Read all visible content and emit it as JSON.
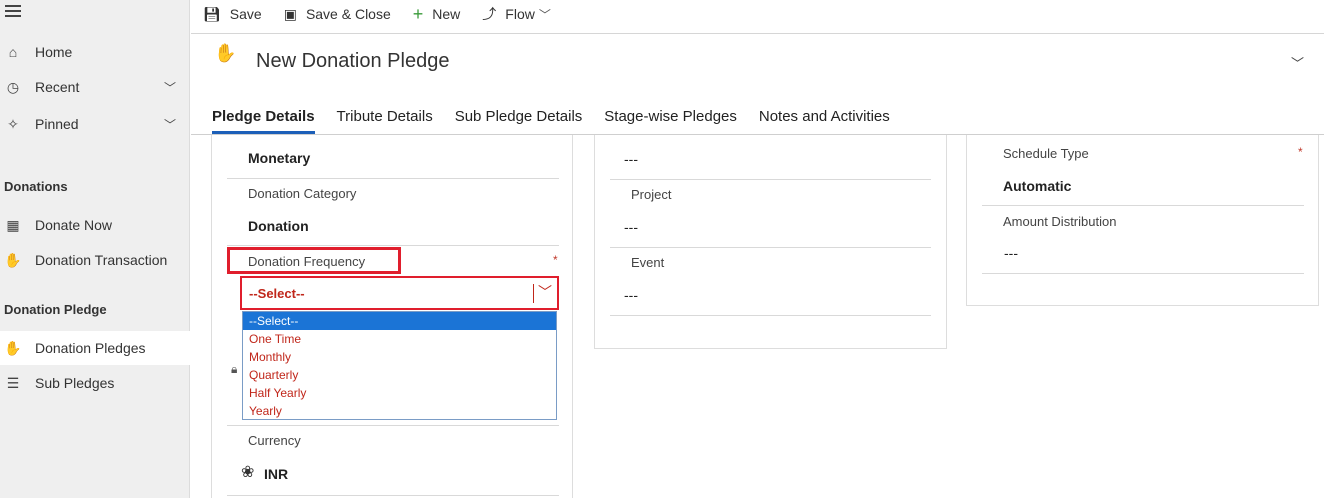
{
  "commands": {
    "save": "Save",
    "save_close": "Save & Close",
    "new": "New",
    "flow": "Flow"
  },
  "sidebar": {
    "items": [
      {
        "label": "Home",
        "icon": "home-icon"
      },
      {
        "label": "Recent",
        "icon": "clock-icon"
      },
      {
        "label": "Pinned",
        "icon": "pin-icon"
      }
    ],
    "group_donations": "Donations",
    "donations_items": [
      {
        "label": "Donate Now",
        "icon": "calculator-icon"
      },
      {
        "label": "Donation Transaction",
        "icon": "hand-money-icon"
      }
    ],
    "group_pledge": "Donation Pledge",
    "pledge_items": [
      {
        "label": "Donation Pledges",
        "icon": "hand-icon"
      },
      {
        "label": "Sub Pledges",
        "icon": "coins-icon"
      }
    ]
  },
  "header": {
    "title": "New Donation Pledge"
  },
  "tabs": [
    "Pledge Details",
    "Tribute Details",
    "Sub Pledge Details",
    "Stage-wise Pledges",
    "Notes and Activities"
  ],
  "left_panel": {
    "monetary_value": "Monetary",
    "category_label": "Donation Category",
    "category_value": "Donation",
    "frequency_label": "Donation Frequency",
    "required_mark": "*",
    "select_value": "--Select--",
    "options": [
      "--Select--",
      "One Time",
      "Monthly",
      "Quarterly",
      "Half Yearly",
      "Yearly"
    ],
    "currency_label": "Currency",
    "currency_value": "INR"
  },
  "mid_panel": {
    "empty1": "---",
    "project_label": "Project",
    "project_value": "---",
    "event_label": "Event",
    "event_value": "---"
  },
  "right_panel": {
    "schedule_label": "Schedule Type",
    "required_mark": "*",
    "schedule_value": "Automatic",
    "amount_label": "Amount Distribution",
    "amount_value": "---"
  },
  "colors": {
    "accent": "#1c5fb8",
    "highlight": "#e01e2d",
    "option_text": "#c0261a",
    "selected_option_bg": "#1b74d6"
  }
}
